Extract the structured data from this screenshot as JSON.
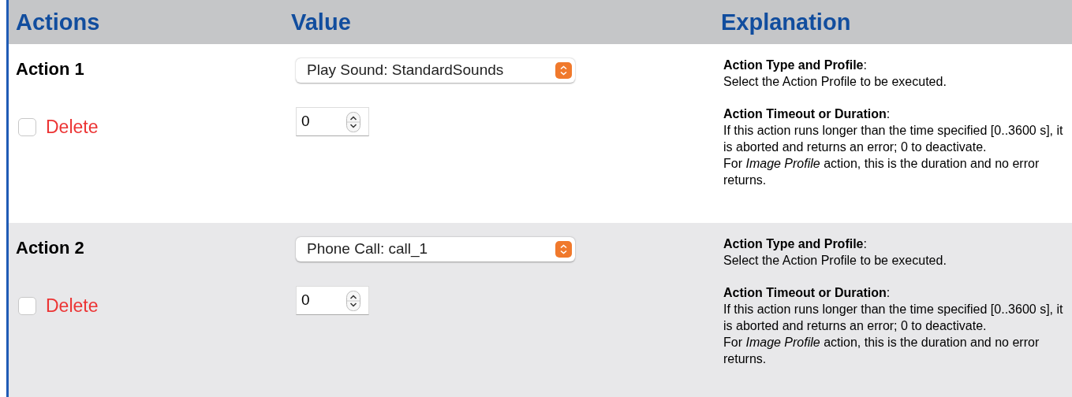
{
  "columns": [
    "Actions",
    "Value",
    "Explanation"
  ],
  "actions": [
    {
      "title": "Action 1",
      "delete": {
        "label": "Delete",
        "checked": false
      },
      "profile": "Play Sound: StandardSounds",
      "timeout": "0",
      "explanations": [
        {
          "heading": "**Action Type and Profile**:",
          "lines": [
            "Select the Action Profile to be executed."
          ]
        },
        {
          "heading": "**Action Timeout or Duration**:",
          "lines": [
            "If this action runs longer than the time specified [0..3600 s], it is aborted and returns an error; 0 to deactivate.",
            "For *Image Profile* action, this is the duration and no error returns."
          ]
        }
      ]
    },
    {
      "title": "Action 2",
      "delete": {
        "label": "Delete",
        "checked": false
      },
      "profile": "Phone Call: call_1",
      "timeout": "0",
      "explanations": [
        {
          "heading": "**Action Type and Profile**:",
          "lines": [
            "Select the Action Profile to be executed."
          ]
        },
        {
          "heading": "**Action Timeout or Duration**:",
          "lines": [
            "If this action runs longer than the time specified [0..3600 s], it is aborted and returns an error; 0 to deactivate.",
            "For *Image Profile* action, this is the duration and no error returns."
          ]
        }
      ]
    }
  ]
}
